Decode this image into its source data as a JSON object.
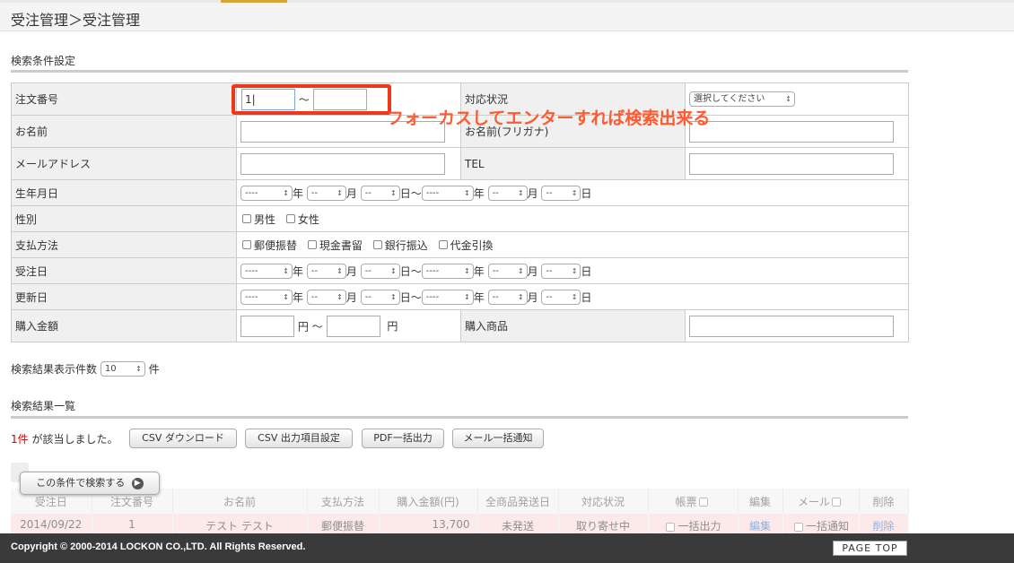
{
  "page_title": "受注管理＞受注管理",
  "colors": {
    "accent_tab": "#d5a536",
    "highlight": "#ea3a1a",
    "annotation": "#ff5a30",
    "result_row": "#f9d7d8",
    "count_red": "#cc0000"
  },
  "search_section": {
    "heading": "検索条件設定",
    "order_no": {
      "label": "注文番号",
      "from_value": "1|",
      "sep": "〜"
    },
    "status": {
      "label": "対応状況",
      "select": "選択してください"
    },
    "name": {
      "label": "お名前",
      "kana_label": "お名前(フリガナ)"
    },
    "email": {
      "label": "メールアドレス",
      "tel_label": "TEL"
    },
    "birthday": {
      "label": "生年月日"
    },
    "sex": {
      "label": "性別",
      "options": [
        "男性",
        "女性"
      ]
    },
    "payment": {
      "label": "支払方法",
      "options": [
        "郵便振替",
        "現金書留",
        "銀行振込",
        "代金引換"
      ]
    },
    "order_date": {
      "label": "受注日"
    },
    "update_date": {
      "label": "更新日"
    },
    "date_parts": {
      "year_select": "----",
      "md_select": "--",
      "year": "年",
      "month": "月",
      "day": "日",
      "tilde": "〜"
    },
    "amount": {
      "label": "購入金額",
      "unit": "円",
      "sep": "〜",
      "product_label": "購入商品"
    },
    "per_page": {
      "label": "検索結果表示件数",
      "value": "10",
      "unit": "件"
    }
  },
  "annotation": "フォーカスしてエンターすれば検索出来る",
  "results": {
    "heading": "検索結果一覧",
    "count": "1件",
    "count_suffix": "が該当しました。",
    "buttons": [
      "CSV ダウンロード",
      "CSV 出力項目設定",
      "PDF一括出力",
      "メール一括通知"
    ],
    "search_button": "この条件で検索する",
    "columns": [
      "受注日",
      "注文番号",
      "お名前",
      "支払方法",
      "購入金額(円)",
      "全商品発送日",
      "対応状況",
      "帳票",
      "編集",
      "メール",
      "削除"
    ],
    "rows": [
      {
        "date": "2014/09/22",
        "order_no": "1",
        "name": "テスト テスト",
        "payment": "郵便振替",
        "amount": "13,700",
        "ship": "未発送",
        "status": "取り寄せ中",
        "doc": "一括出力",
        "edit": "編集",
        "mail": "一括通知",
        "del": "削除"
      }
    ]
  },
  "footer": {
    "copyright": "Copyright © 2000-2014 LOCKON CO.,LTD. All Rights Reserved.",
    "page_top": "PAGE TOP"
  }
}
